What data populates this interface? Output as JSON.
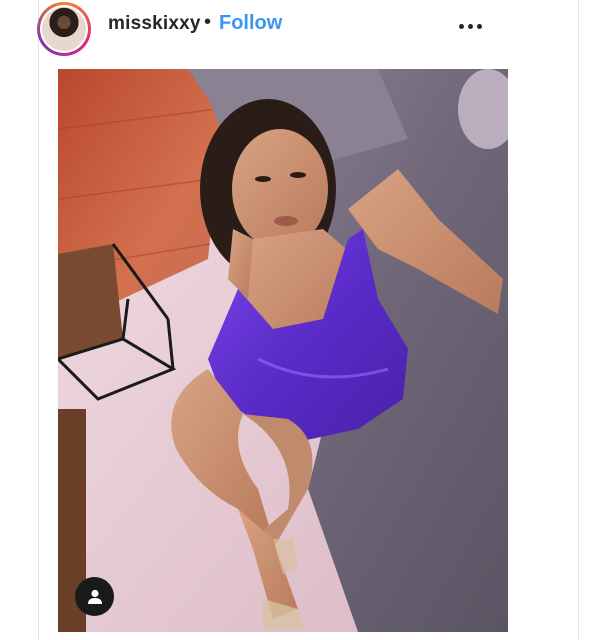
{
  "post": {
    "username": "misskixxy",
    "separator": "•",
    "follow_label": "Follow"
  },
  "icons": {
    "avatar": "profile-avatar",
    "more": "more-options-icon",
    "tag": "user-tag-icon"
  },
  "colors": {
    "follow": "#3897f0",
    "text": "#262626",
    "dress": "#6a33d6",
    "wall": "#c85a3c",
    "blanket": "#7d7686"
  }
}
